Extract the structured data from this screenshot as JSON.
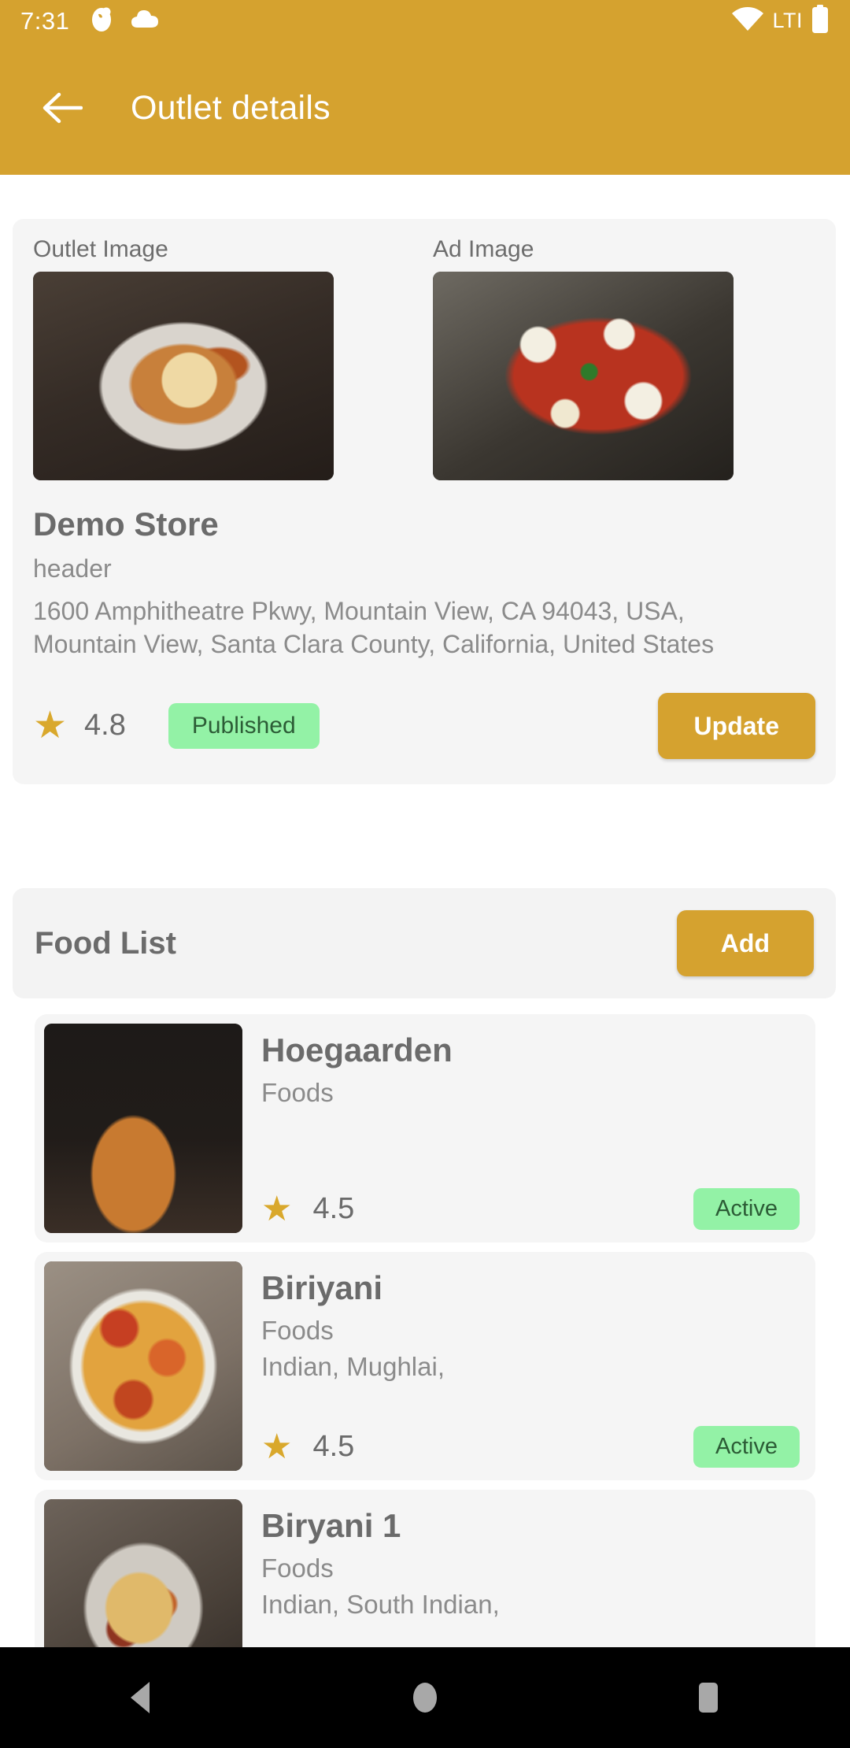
{
  "status_bar": {
    "time": "7:31",
    "left_icons": [
      "app-notification-icon",
      "cloud-icon"
    ],
    "right": {
      "wifi_icon": "wifi-icon",
      "network_label": "LTI",
      "battery_icon": "battery-icon"
    }
  },
  "app_bar": {
    "back_icon": "arrow-left-icon",
    "title": "Outlet details",
    "background": "#d5a22f"
  },
  "outlet_card": {
    "outlet_image_label": "Outlet Image",
    "ad_image_label": "Ad Image",
    "outlet_image_alt": "spaghetti-and-meatballs-photo",
    "ad_image_alt": "gnocchi-with-mozzarella-photo",
    "name": "Demo Store",
    "subtitle": "header",
    "address": "1600 Amphitheatre Pkwy, Mountain View, CA 94043, USA, Mountain View, Santa Clara County, California, United States",
    "rating": "4.8",
    "status_badge": "Published",
    "update_button": "Update"
  },
  "food_list": {
    "title": "Food List",
    "add_button": "Add",
    "items": [
      {
        "name": "Hoegaarden",
        "category": "Foods",
        "tags": "",
        "rating": "4.5",
        "status": "Active",
        "image_alt": "spaghetti-on-fork-photo"
      },
      {
        "name": "Biriyani",
        "category": "Foods",
        "tags": "Indian, Mughlai,",
        "rating": "4.5",
        "status": "Active",
        "image_alt": "baked-pizza-photo"
      },
      {
        "name": "Biryani 1",
        "category": "Foods",
        "tags": "Indian, South Indian,",
        "rating": "",
        "status": "",
        "image_alt": "spaghetti-bowl-photo"
      }
    ]
  },
  "nav_bar": {
    "back_icon": "triangle-back-icon",
    "home_icon": "circle-home-icon",
    "recents_icon": "square-recents-icon"
  },
  "colors": {
    "brand": "#d5a22f",
    "badge_bg": "#93f2a6",
    "badge_text": "#2c5c36",
    "star": "#d9a82c",
    "card_bg": "#f5f5f5",
    "text_primary": "#6b6b6b",
    "text_secondary": "#8b8b8b"
  }
}
